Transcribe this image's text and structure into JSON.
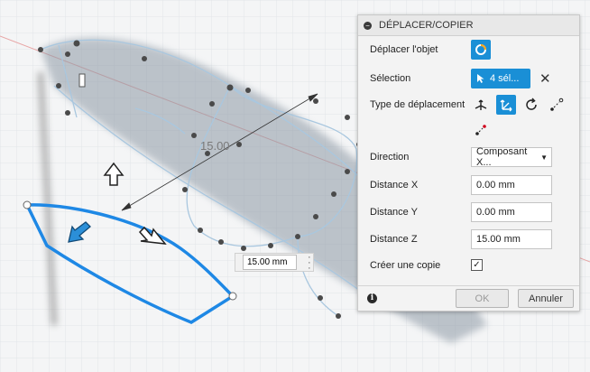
{
  "panel": {
    "title": "DÉPLACER/COPIER",
    "move_object_label": "Déplacer l'objet",
    "selection_label": "Sélection",
    "selection_value": "4 sél...",
    "move_type_label": "Type de déplacement",
    "direction_label": "Direction",
    "direction_value": "Composant X...",
    "distance_x_label": "Distance X",
    "distance_x_value": "0.00 mm",
    "distance_y_label": "Distance Y",
    "distance_y_value": "0.00 mm",
    "distance_z_label": "Distance Z",
    "distance_z_value": "15.00 mm",
    "create_copy_label": "Créer une copie",
    "create_copy_checked": "✓",
    "ok_label": "OK",
    "cancel_label": "Annuler"
  },
  "viewport": {
    "dimension_label": "15.00",
    "inline_input_value": "15.00 mm"
  },
  "colors": {
    "accent": "#1a8fd6",
    "selected_curve": "#1e88e5",
    "ghost_body": "#9fb3c4"
  }
}
